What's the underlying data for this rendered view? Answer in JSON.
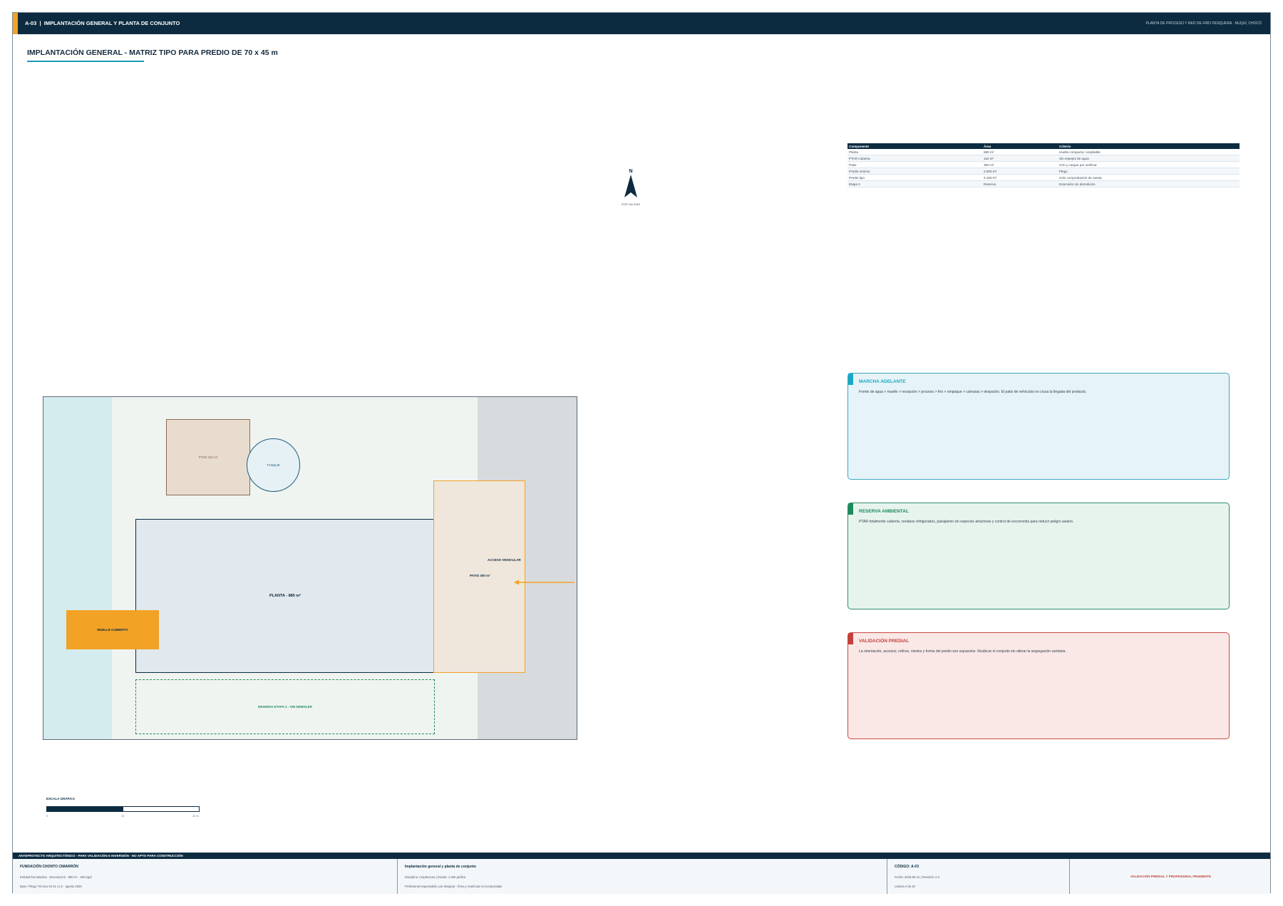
{
  "header": {
    "code": "A-03",
    "sheet_title": "IMPLANTACIÓN GENERAL Y PLANTA DE CONJUNTO",
    "project": "PLANTA DE PROCESO Y RED DE FRÍO PESQUERA · NUQUÍ, CHOCÓ",
    "accent_color": "#f2a225",
    "bar_color": "#0c2b40"
  },
  "main": {
    "title": "IMPLANTACIÓN GENERAL - MATRIZ TIPO PARA PREDIO DE 70 x 45 m"
  },
  "north": {
    "letter": "N",
    "note": "POR VALIDAR"
  },
  "table": {
    "headers": [
      "Componente",
      "Área",
      "Criterio"
    ],
    "rows": [
      [
        "Planta",
        "880 m²",
        "Huella compacta / ampliable"
      ],
      [
        "PTAR cubierta",
        "110 m²",
        "Sin espejos de agua"
      ],
      [
        "Patio",
        "300 m²",
        "Giro y cargue por verificar"
      ],
      [
        "Predio mínimo",
        "2.000 m²",
        "Plego"
      ],
      [
        "Predio tipo",
        "3.150 m²",
        "Solo comprobación de rasola"
      ],
      [
        "Etapa 2",
        "Reserva",
        "Extensión sin demolición"
      ]
    ]
  },
  "cards": [
    {
      "title": "MARCHA ADELANTE",
      "body": "Frente de agua > muelle > recepción > proceso > frío > empaque > cámaras > despacho. El patio de vehículos no cruza la llegada del producto."
    },
    {
      "title": "RESERVA AMBIENTAL",
      "body": "PTAR totalmente cubierta, residuos refrigerados, paisajismo sin especies atractoras y control de escorrentía para reducir peligro aviario."
    },
    {
      "title": "VALIDACIÓN PREDIAL",
      "body": "La orientación, accesos, rellnos, niveles y forma del predio son supuestos. Reubicar el conjunto sin alterar la segregación sanitaria."
    }
  ],
  "site": {
    "ptar": "PTAR 110 m²",
    "tanque": "TANQUE",
    "planta": "PLANTA - 880 m²",
    "acceso": "ACCESO VEHICULAR",
    "patio": "PATIO 300 m²",
    "muelle": "MUELLE CUBIERTO",
    "reserva": "RESERVA ETAPA 2 - SIN DEMOLER"
  },
  "scale": {
    "label": "ESCALA GRÁFICA",
    "ticks": [
      "0",
      "10",
      "20 m"
    ],
    "fill_fraction": 0.5
  },
  "footer": {
    "banner": "ANTEPROYECTO ARQUITECTÓNICO - PARA VALIDACIÓN E INVERSIÓN - NO APTO PARA CONSTRUCCIÓN",
    "org": "FUNDACIÓN CHONTO CIMARRÓN",
    "org_line1": "Entidad formuladora · Escenario B · 880 m² · 500 kg/d",
    "org_line2": "Base: Pliego Técnico 04-11 v1.0 · agosto 2026",
    "sheet": "Implantación general y planta de conjunto",
    "sheet_line1": "Disciplina: Arquitectura  |  Escala: 1:250 gráfica",
    "sheet_line2": "Profesional responsable: por designar - firma y matrícula no incorporadas",
    "code": "CÓDIGO: A-03",
    "code_line1": "Fecha: 2026-08-12  |  Revisión: 2.0",
    "code_line2": "Lámina 4 de 20",
    "status": "VALIDACIÓN PREDIAL Y PROFESIONAL PENDIENTE"
  }
}
